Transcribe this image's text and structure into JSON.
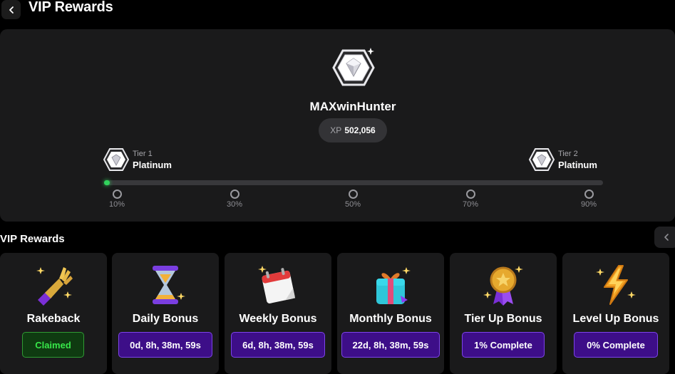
{
  "header": {
    "title": "VIP Rewards"
  },
  "profile": {
    "username": "MAXwinHunter",
    "xp_label": "XP",
    "xp_value": "502,056"
  },
  "tiers": {
    "current": {
      "label": "Tier 1",
      "name": "Platinum"
    },
    "next": {
      "label": "Tier 2",
      "name": "Platinum"
    }
  },
  "progress": {
    "fraction": 0.005,
    "milestones": [
      "10%",
      "30%",
      "50%",
      "70%",
      "90%"
    ]
  },
  "rewards": {
    "title": "VIP Rewards",
    "items": [
      {
        "title": "Rakeback",
        "status": "Claimed",
        "state": "claimed",
        "icon": "rakeback-hand-icon"
      },
      {
        "title": "Daily Bonus",
        "status": "0d, 8h, 38m, 59s",
        "state": "timer",
        "icon": "hourglass-icon"
      },
      {
        "title": "Weekly Bonus",
        "status": "6d, 8h, 38m, 59s",
        "state": "timer",
        "icon": "calendar-icon"
      },
      {
        "title": "Monthly Bonus",
        "status": "22d, 8h, 38m, 59s",
        "state": "timer",
        "icon": "gift-icon"
      },
      {
        "title": "Tier Up Bonus",
        "status": "1% Complete",
        "state": "timer",
        "icon": "medal-icon"
      },
      {
        "title": "Level Up Bonus",
        "status": "0% Complete",
        "state": "timer",
        "icon": "lightning-icon"
      }
    ]
  },
  "colors": {
    "background": "#000000",
    "panel": "#1a1a1b",
    "progress_fill": "#31d35c",
    "claimed_text": "#37e649",
    "timer_bg": "#3d0e88",
    "timer_border": "#7d43ea"
  }
}
